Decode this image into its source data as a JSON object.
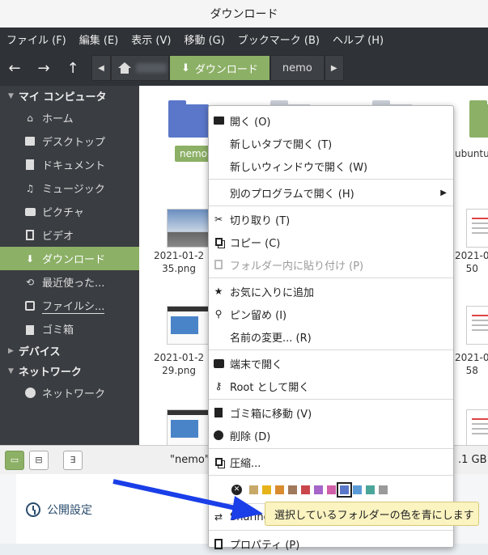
{
  "window": {
    "title": "ダウンロード"
  },
  "menubar": [
    "ファイル (F)",
    "編集 (E)",
    "表示 (V)",
    "移動 (G)",
    "ブックマーク (B)",
    "ヘルプ (H)"
  ],
  "toolbar": {
    "back_icon": "←",
    "forward_icon": "→",
    "up_icon": "↑",
    "path_active": "ダウンロード",
    "path_next": "nemo"
  },
  "sidebar": {
    "sections": {
      "my_computer": "マイ コンピュータ",
      "devices": "デバイス",
      "network": "ネットワーク"
    },
    "items": [
      {
        "label": "ホーム",
        "icon": "home-icon"
      },
      {
        "label": "デスクトップ",
        "icon": "desktop-icon"
      },
      {
        "label": "ドキュメント",
        "icon": "document-icon"
      },
      {
        "label": "ミュージック",
        "icon": "music-icon"
      },
      {
        "label": "ピクチャ",
        "icon": "camera-icon"
      },
      {
        "label": "ビデオ",
        "icon": "film-icon"
      },
      {
        "label": "ダウンロード",
        "icon": "download-icon"
      },
      {
        "label": "最近使った...",
        "icon": "history-icon"
      },
      {
        "label": "ファイルシ...",
        "icon": "filesystem-icon"
      },
      {
        "label": "ゴミ箱",
        "icon": "trash-icon"
      }
    ],
    "network_item": "ネットワーク"
  },
  "content": {
    "selected_folder": "nemo",
    "ubuntu_label": "ubuntu",
    "files": [
      {
        "l1": "2021-01-2",
        "l2": "35.png"
      },
      {
        "l1": "2021-0",
        "l2": "50"
      },
      {
        "l1": "2021-01-2",
        "l2": "29.png"
      },
      {
        "l1": "2021-0",
        "l2": "58"
      }
    ]
  },
  "statusbar": {
    "status_text": "\"nemo\"",
    "free_space": ".1 GB",
    "btn3": "∃"
  },
  "context_menu": {
    "open": "開く (O)",
    "open_new_tab": "新しいタブで開く (T)",
    "open_new_window": "新しいウィンドウで開く (W)",
    "open_with": "別のプログラムで開く (H)",
    "cut": "切り取り (T)",
    "copy": "コピー (C)",
    "paste_into": "フォルダー内に貼り付け (P)",
    "add_favorite": "お気に入りに追加",
    "pin": "ピン留め (I)",
    "rename": "名前の変更... (R)",
    "open_terminal": "端末で開く",
    "open_as_root": "Root として開く",
    "move_to_trash": "ゴミ箱に移動 (V)",
    "delete": "削除 (D)",
    "compress": "圧縮...",
    "sharing": "Sharing",
    "properties": "プロパティ (P)",
    "swatch_colors": [
      "#c8a96a",
      "#e6b319",
      "#d98b2e",
      "#a0785a",
      "#c9464a",
      "#a565c9",
      "#d05fa8",
      "#5b77c9",
      "#5b9bd5",
      "#4ba69a",
      "#9a9a9a"
    ],
    "selected_color": "#5b77c9"
  },
  "tooltip": {
    "text": "選択しているフォルダーの色を青にします"
  },
  "background": {
    "settings_label": "公開設定"
  },
  "colors": {
    "accent": "#8cb066",
    "dark": "#2f3236",
    "arrow": "#1a3ee8"
  }
}
